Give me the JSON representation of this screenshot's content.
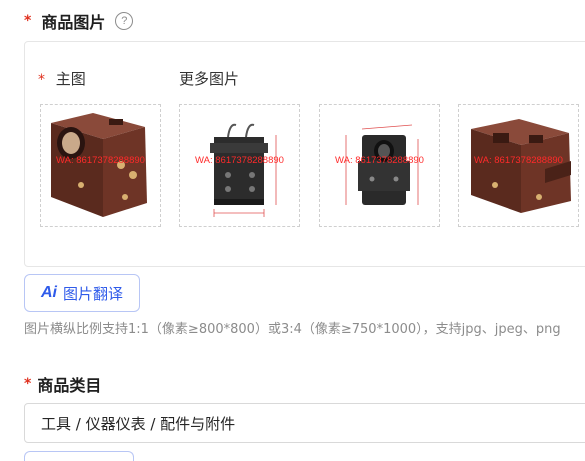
{
  "product_images": {
    "title": "商品图片",
    "required_mark": "*",
    "help_icon": "question-circle-icon",
    "main_label": "主图",
    "more_label": "更多图片",
    "images": [
      {
        "name": "main-image",
        "watermark": "WA: 8617378288890"
      },
      {
        "name": "more-image-1",
        "watermark": "WA: 8617378288890"
      },
      {
        "name": "more-image-2",
        "watermark": "WA: 8617378288890"
      },
      {
        "name": "more-image-3",
        "watermark": "WA: 8617378288890"
      }
    ]
  },
  "ai_translate": {
    "icon_text": "Ai",
    "label": "图片翻译"
  },
  "hint": "图片横纵比例支持1:1（像素≥800*800）或3:4（像素≥750*1000），支持jpg、jpeg、png",
  "category": {
    "title": "商品类目",
    "required_mark": "*",
    "value": "工具 / 仪器仪表 / 配件与附件"
  },
  "colors": {
    "required": "#e0301e",
    "accent": "#2f5bea",
    "hint": "#8c8c8c"
  }
}
